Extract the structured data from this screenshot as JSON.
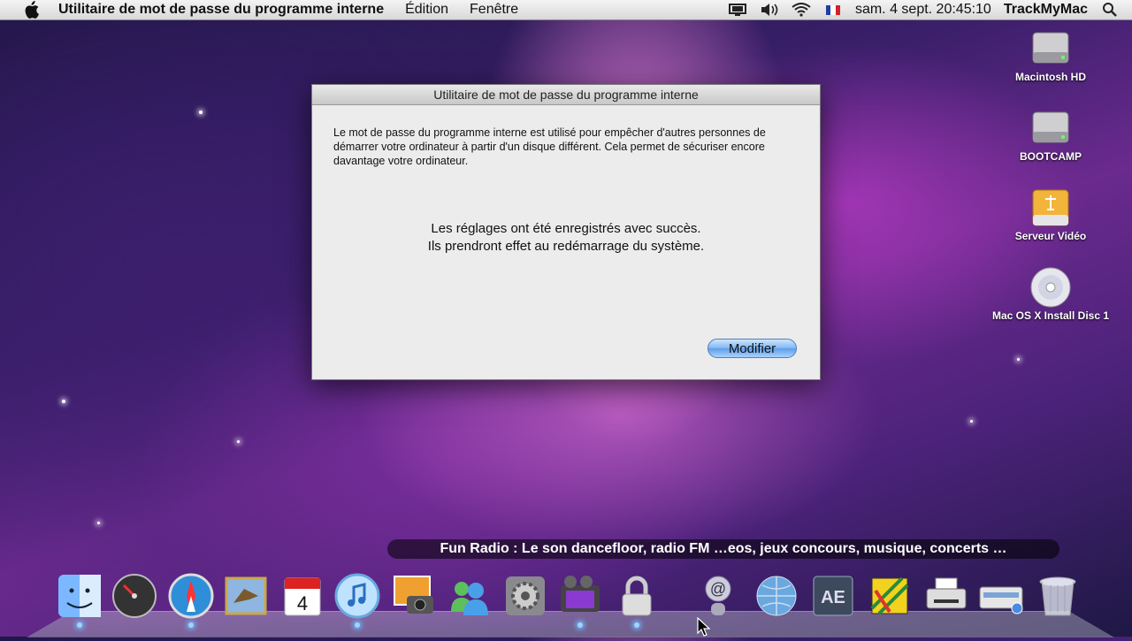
{
  "menubar": {
    "app_name": "Utilitaire de mot de passe du programme interne",
    "menus": [
      "Édition",
      "Fenêtre"
    ],
    "clock": "sam. 4 sept.  20:45:10",
    "user": "TrackMyMac",
    "flag_colors": [
      "#1d3fa0",
      "#ffffff",
      "#d3222a"
    ]
  },
  "dialog": {
    "title": "Utilitaire de mot de passe du programme interne",
    "info_text": "Le mot de passe du programme interne est utilisé pour empêcher d'autres personnes de démarrer votre ordinateur à partir d'un disque différent. Cela permet de sécuriser encore davantage votre ordinateur.",
    "message_line1": "Les réglages ont été enregistrés avec succès.",
    "message_line2": "Ils prendront effet au redémarrage du système.",
    "button_label": "Modifier"
  },
  "desktop": {
    "icons": [
      {
        "label": "Macintosh HD",
        "icon": "hard-drive-icon"
      },
      {
        "label": "BOOTCAMP",
        "icon": "hard-drive-icon"
      },
      {
        "label": "Serveur Vidéo",
        "icon": "usb-drive-icon"
      },
      {
        "label": "Mac OS X Install Disc 1",
        "icon": "dvd-disc-icon"
      }
    ]
  },
  "dock": {
    "tooltip": "Fun Radio : Le son dancefloor, radio FM …eos, jeux concours, musique, concerts …",
    "items": [
      "finder-icon",
      "dashboard-icon",
      "safari-icon",
      "mail-icon",
      "ical-icon",
      "itunes-icon",
      "iphoto-icon",
      "ichat-icon",
      "system-preferences-icon",
      "imovie-icon",
      "lock-icon",
      "address-at-icon",
      "network-globe-icon",
      "after-effects-icon",
      "stickies-icon",
      "printer-icon",
      "scanner-icon",
      "trash-icon"
    ]
  },
  "colors": {
    "button_accent": "#5e9de8",
    "dock_indicator": "#9fd4ff"
  }
}
